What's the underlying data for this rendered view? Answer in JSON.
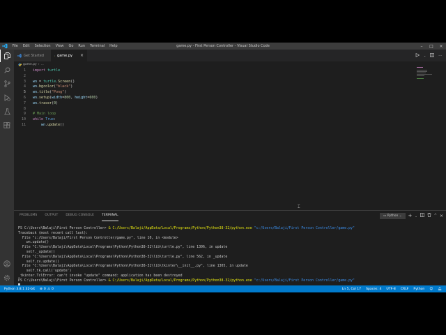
{
  "window": {
    "title": "game.py - First Person Controller - Visual Studio Code",
    "menu": [
      "File",
      "Edit",
      "Selection",
      "View",
      "Go",
      "Run",
      "Terminal",
      "Help"
    ],
    "controls": [
      "minimize-icon",
      "maximize-icon",
      "close-icon"
    ]
  },
  "activity_bar": [
    "explorer-icon",
    "search-icon",
    "source-control-icon",
    "run-debug-icon",
    "testing-icon",
    "extensions-icon",
    "account-icon",
    "settings-gear-icon"
  ],
  "tabs": [
    {
      "label": "Get Started",
      "active": false
    },
    {
      "label": "game.py",
      "active": true
    }
  ],
  "breadcrumb": {
    "file": "game.py",
    "trail": "..."
  },
  "editor": {
    "lines": [
      {
        "n": "1",
        "tokens": [
          [
            "kw",
            "import"
          ],
          [
            "",
            " "
          ],
          [
            "ident",
            "turtle"
          ]
        ]
      },
      {
        "n": "2",
        "tokens": []
      },
      {
        "n": "3",
        "tokens": [
          [
            "var",
            "wn"
          ],
          [
            "",
            " = "
          ],
          [
            "ident",
            "turtle"
          ],
          [
            "",
            "."
          ],
          [
            "fn",
            "Screen"
          ],
          [
            "",
            "()"
          ]
        ]
      },
      {
        "n": "4",
        "tokens": [
          [
            "var",
            "wn"
          ],
          [
            "",
            "."
          ],
          [
            "fn",
            "bgcolor"
          ],
          [
            "",
            "("
          ],
          [
            "str",
            "\"black\""
          ],
          [
            "",
            ")"
          ]
        ]
      },
      {
        "n": "5",
        "tokens": [
          [
            "var",
            "wn"
          ],
          [
            "",
            "."
          ],
          [
            "fn",
            "title"
          ],
          [
            "",
            "("
          ],
          [
            "str",
            "\"Pong\""
          ],
          [
            "",
            ")"
          ]
        ]
      },
      {
        "n": "6",
        "tokens": [
          [
            "var",
            "wn"
          ],
          [
            "",
            "."
          ],
          [
            "fn",
            "setup"
          ],
          [
            "",
            "("
          ],
          [
            "var",
            "width"
          ],
          [
            "",
            "="
          ],
          [
            "num",
            "800"
          ],
          [
            "",
            ", "
          ],
          [
            "var",
            "height"
          ],
          [
            "",
            "="
          ],
          [
            "num",
            "600"
          ],
          [
            "",
            ")"
          ]
        ]
      },
      {
        "n": "7",
        "tokens": [
          [
            "var",
            "wn"
          ],
          [
            "",
            "."
          ],
          [
            "fn",
            "tracer"
          ],
          [
            "",
            "("
          ],
          [
            "num",
            "0"
          ],
          [
            "",
            ")"
          ]
        ]
      },
      {
        "n": "8",
        "tokens": []
      },
      {
        "n": "9",
        "tokens": [
          [
            "cmt",
            "# Main loop"
          ]
        ]
      },
      {
        "n": "10",
        "tokens": [
          [
            "kw",
            "while"
          ],
          [
            "",
            " "
          ],
          [
            "kw-blue",
            "True"
          ],
          [
            "",
            ":"
          ]
        ]
      },
      {
        "n": "11",
        "tokens": [
          [
            "",
            "    "
          ],
          [
            "var",
            "wn"
          ],
          [
            "",
            "."
          ],
          [
            "fn",
            "update"
          ],
          [
            "",
            "()"
          ]
        ]
      }
    ]
  },
  "panel": {
    "tabs": [
      "PROBLEMS",
      "OUTPUT",
      "DEBUG CONSOLE",
      "TERMINAL"
    ],
    "active_tab": "TERMINAL",
    "terminal_select": "Python",
    "actions": [
      "add-icon",
      "chevron-down-icon",
      "split-icon",
      "trash-icon",
      "chevron-up-icon",
      "close-icon"
    ],
    "terminal_lines": [
      [
        [
          "",
          "PS C:\\Users\\Balaji\\First Person Controller> "
        ],
        [
          "t-yellow",
          "& C:/Users/Balaji/AppData/Local/Programs/Python/Python38-32/python.exe"
        ],
        [
          "",
          " "
        ],
        [
          "t-blue",
          "\"c:/Users/Balaji/First Person Controller/game.py\""
        ]
      ],
      [
        [
          "",
          "Traceback (most recent call last):"
        ]
      ],
      [
        [
          "",
          "  File \"c:/Users/Balaji/First Person Controller/game.py\", line 10, in <module>"
        ]
      ],
      [
        [
          "",
          "    wn.update()"
        ]
      ],
      [
        [
          "",
          "  File \"C:\\Users\\Balaji\\AppData\\Local\\Programs\\Python\\Python38-32\\lib\\turtle.py\", line 1306, in update"
        ]
      ],
      [
        [
          "",
          "    self._update()"
        ]
      ],
      [
        [
          "",
          "  File \"C:\\Users\\Balaji\\AppData\\Local\\Programs\\Python\\Python38-32\\lib\\turtle.py\", line 562, in _update"
        ]
      ],
      [
        [
          "",
          "    self.cv.update()"
        ]
      ],
      [
        [
          "",
          "  File \"C:\\Users\\Balaji\\AppData\\Local\\Programs\\Python\\Python38-32\\lib\\tkinter\\__init__.py\", line 1305, in update"
        ]
      ],
      [
        [
          "",
          "    self.tk.call('update')"
        ]
      ],
      [
        [
          "",
          "_tkinter.TclError: can't invoke \"update\" command: application has been destroyed"
        ]
      ],
      [
        [
          "",
          "PS C:\\Users\\Balaji\\First Person Controller> "
        ],
        [
          "t-yellow",
          "& C:/Users/Balaji/AppData/Local/Programs/Python/Python38-32/python.exe"
        ],
        [
          "",
          " "
        ],
        [
          "t-blue",
          "\"c:/Users/Balaji/First Person Controller/game.py\""
        ]
      ],
      [
        [
          "cursor",
          ""
        ]
      ]
    ]
  },
  "status": {
    "interpreter": "Python 3.8.1 32-bit",
    "errors": "0",
    "warnings": "0",
    "position": "Ln 5, Col 17",
    "spaces": "Spaces: 4",
    "encoding": "UTF-8",
    "eol": "CRLF",
    "language": "Python"
  },
  "colors": {
    "status_bar": "#007acc",
    "editor_bg": "#1e1e1e",
    "activity_bar": "#333333",
    "title_bar": "#3c3c3c"
  }
}
